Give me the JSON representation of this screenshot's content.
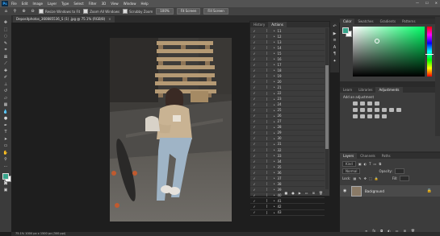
{
  "app": {
    "logo": "Ps"
  },
  "menu": [
    "File",
    "Edit",
    "Image",
    "Layer",
    "Type",
    "Select",
    "Filter",
    "3D",
    "View",
    "Window",
    "Help"
  ],
  "options": {
    "resize_label": "Resize Windows to Fit",
    "zoom_all_label": "Zoom All Windows",
    "scrubby_label": "Scrubby Zoom",
    "zoom_pct": "100%",
    "fit_label": "Fit Screen",
    "fill_label": "Fill Screen"
  },
  "document": {
    "tab_title": "Depositphotos_360885536_S (1) .jpg @ 75.1% (RGB/8)"
  },
  "status": {
    "text": "75.1%    1000 px x 1500 px (300 ppi)"
  },
  "tool_icons": [
    "move-icon",
    "marquee-icon",
    "lasso-icon",
    "quick-select-icon",
    "crop-icon",
    "frame-icon",
    "eyedropper-icon",
    "healing-icon",
    "brush-icon",
    "stamp-icon",
    "history-brush-icon",
    "eraser-icon",
    "gradient-icon",
    "blur-icon",
    "dodge-icon",
    "pen-icon",
    "type-icon",
    "path-select-icon",
    "shape-icon",
    "hand-icon",
    "zoom-icon",
    "more-icon"
  ],
  "actions_panel": {
    "tabs": [
      "History",
      "Actions"
    ],
    "active_tab": "Actions",
    "rows": [
      "11",
      "12",
      "13",
      "14",
      "15",
      "16",
      "17",
      "18",
      "19",
      "20",
      "21",
      "22",
      "23",
      "24",
      "25",
      "26",
      "27",
      "28",
      "29",
      "30",
      "31",
      "32",
      "33",
      "34",
      "35",
      "36",
      "37",
      "38",
      "39",
      "40",
      "41",
      "42",
      "43"
    ]
  },
  "color_panel": {
    "tabs": [
      "Color",
      "Swatches",
      "Gradients",
      "Patterns"
    ],
    "active_tab": "Color",
    "foreground": "#37a48b",
    "background": "#ffffff"
  },
  "adjust_panel": {
    "tabs": [
      "Learn",
      "Libraries",
      "Adjustments"
    ],
    "active_tab": "Adjustments",
    "title": "Add an adjustment"
  },
  "layers_panel": {
    "tabs": [
      "Layers",
      "Channels",
      "Paths"
    ],
    "active_tab": "Layers",
    "kind_label": "Kind",
    "blend_mode": "Normal",
    "opacity_label": "Opacity:",
    "lock_label": "Lock:",
    "fill_label": "Fill:",
    "layer_name": "Background"
  }
}
